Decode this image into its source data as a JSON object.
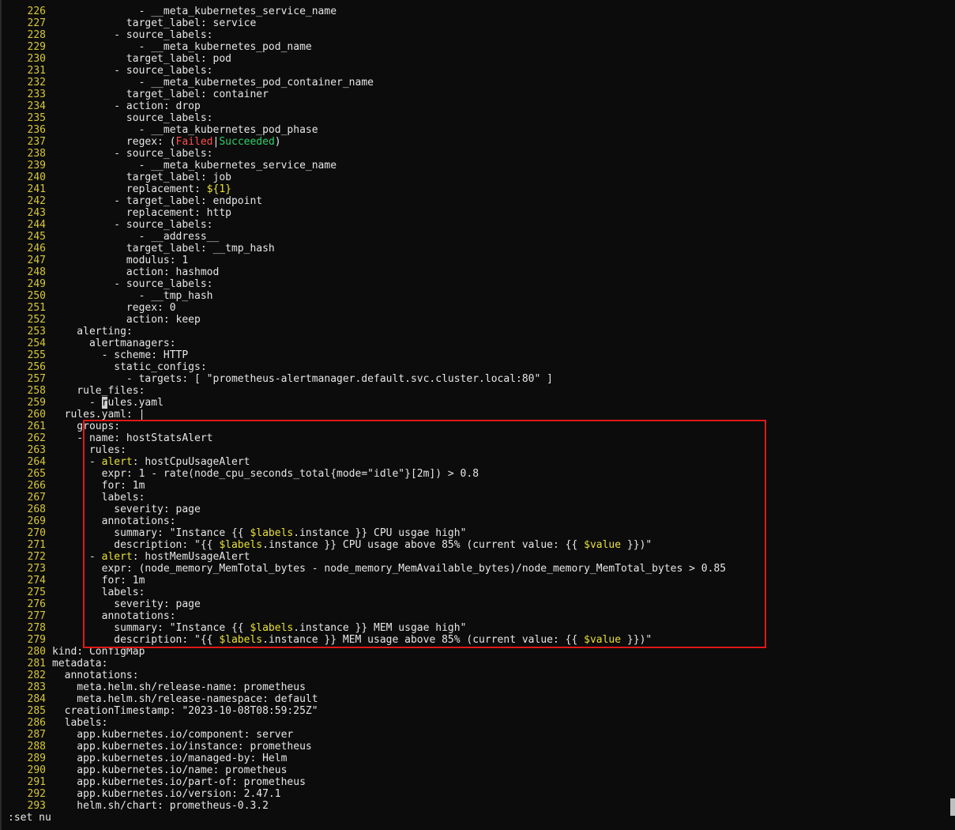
{
  "editor": {
    "lines": [
      {
        "n": "226",
        "segs": [
          {
            "t": "              - __meta_kubernetes_service_name"
          }
        ]
      },
      {
        "n": "227",
        "segs": [
          {
            "t": "            target_label: service"
          }
        ]
      },
      {
        "n": "228",
        "segs": [
          {
            "t": "          - source_labels:"
          }
        ]
      },
      {
        "n": "229",
        "segs": [
          {
            "t": "              - __meta_kubernetes_pod_name"
          }
        ]
      },
      {
        "n": "230",
        "segs": [
          {
            "t": "            target_label: pod"
          }
        ]
      },
      {
        "n": "231",
        "segs": [
          {
            "t": "          - source_labels:"
          }
        ]
      },
      {
        "n": "232",
        "segs": [
          {
            "t": "              - __meta_kubernetes_pod_container_name"
          }
        ]
      },
      {
        "n": "233",
        "segs": [
          {
            "t": "            target_label: container"
          }
        ]
      },
      {
        "n": "234",
        "segs": [
          {
            "t": "          - action: drop"
          }
        ]
      },
      {
        "n": "235",
        "segs": [
          {
            "t": "            source_labels:"
          }
        ]
      },
      {
        "n": "236",
        "segs": [
          {
            "t": "              - __meta_kubernetes_pod_phase"
          }
        ]
      },
      {
        "n": "237",
        "segs": [
          {
            "t": "            regex: ("
          },
          {
            "t": "Failed",
            "c": "red"
          },
          {
            "t": "|"
          },
          {
            "t": "Succeeded",
            "c": "green"
          },
          {
            "t": ")"
          }
        ]
      },
      {
        "n": "238",
        "segs": [
          {
            "t": "          - source_labels:"
          }
        ]
      },
      {
        "n": "239",
        "segs": [
          {
            "t": "              - __meta_kubernetes_service_name"
          }
        ]
      },
      {
        "n": "240",
        "segs": [
          {
            "t": "            target_label: job"
          }
        ]
      },
      {
        "n": "241",
        "segs": [
          {
            "t": "            replacement: "
          },
          {
            "t": "${1}",
            "c": "yellow"
          }
        ]
      },
      {
        "n": "242",
        "segs": [
          {
            "t": "          - target_label: endpoint"
          }
        ]
      },
      {
        "n": "243",
        "segs": [
          {
            "t": "            replacement: http"
          }
        ]
      },
      {
        "n": "244",
        "segs": [
          {
            "t": "          - source_labels:"
          }
        ]
      },
      {
        "n": "245",
        "segs": [
          {
            "t": "              - __address__"
          }
        ]
      },
      {
        "n": "246",
        "segs": [
          {
            "t": "            target_label: __tmp_hash"
          }
        ]
      },
      {
        "n": "247",
        "segs": [
          {
            "t": "            modulus: 1"
          }
        ]
      },
      {
        "n": "248",
        "segs": [
          {
            "t": "            action: hashmod"
          }
        ]
      },
      {
        "n": "249",
        "segs": [
          {
            "t": "          - source_labels:"
          }
        ]
      },
      {
        "n": "250",
        "segs": [
          {
            "t": "              - __tmp_hash"
          }
        ]
      },
      {
        "n": "251",
        "segs": [
          {
            "t": "            regex: 0"
          }
        ]
      },
      {
        "n": "252",
        "segs": [
          {
            "t": "            action: keep"
          }
        ]
      },
      {
        "n": "253",
        "segs": [
          {
            "t": "    alerting:"
          }
        ]
      },
      {
        "n": "254",
        "segs": [
          {
            "t": "      alertmanagers:"
          }
        ]
      },
      {
        "n": "255",
        "segs": [
          {
            "t": "        - scheme: HTTP"
          }
        ]
      },
      {
        "n": "256",
        "segs": [
          {
            "t": "          static_configs:"
          }
        ]
      },
      {
        "n": "257",
        "segs": [
          {
            "t": "            - targets: [ \"prometheus-alertmanager.default.svc.cluster.local:80\" ]"
          }
        ]
      },
      {
        "n": "258",
        "segs": [
          {
            "t": "    rule_files:"
          }
        ]
      },
      {
        "n": "259",
        "segs": [
          {
            "t": "      - "
          },
          {
            "t": "r",
            "c": "cursor"
          },
          {
            "t": "ules.yaml"
          }
        ]
      },
      {
        "n": "260",
        "segs": [
          {
            "t": "  rules.yaml: |"
          }
        ]
      },
      {
        "n": "261",
        "segs": [
          {
            "t": "    groups:"
          }
        ]
      },
      {
        "n": "262",
        "segs": [
          {
            "t": "    - name: hostStatsAlert"
          }
        ]
      },
      {
        "n": "263",
        "segs": [
          {
            "t": "      rules:"
          }
        ]
      },
      {
        "n": "264",
        "segs": [
          {
            "t": "      - "
          },
          {
            "t": "alert",
            "c": "yellow"
          },
          {
            "t": ": hostCpuUsageAlert"
          }
        ]
      },
      {
        "n": "265",
        "segs": [
          {
            "t": "        expr: 1 - rate(node_cpu_seconds_total{mode=\"idle\"}[2m]) > 0.8"
          }
        ]
      },
      {
        "n": "266",
        "segs": [
          {
            "t": "        for: 1m"
          }
        ]
      },
      {
        "n": "267",
        "segs": [
          {
            "t": "        labels:"
          }
        ]
      },
      {
        "n": "268",
        "segs": [
          {
            "t": "          severity: page"
          }
        ]
      },
      {
        "n": "269",
        "segs": [
          {
            "t": "        annotations:"
          }
        ]
      },
      {
        "n": "270",
        "segs": [
          {
            "t": "          summary: \"Instance {{ "
          },
          {
            "t": "$labels",
            "c": "yellow"
          },
          {
            "t": ".instance }} CPU usgae high\""
          }
        ]
      },
      {
        "n": "271",
        "segs": [
          {
            "t": "          description: \"{{ "
          },
          {
            "t": "$labels",
            "c": "yellow"
          },
          {
            "t": ".instance }} CPU usage above 85% (current value: {{ "
          },
          {
            "t": "$value",
            "c": "yellow"
          },
          {
            "t": " }})\""
          }
        ]
      },
      {
        "n": "272",
        "segs": [
          {
            "t": "      - "
          },
          {
            "t": "alert",
            "c": "yellow"
          },
          {
            "t": ": hostMemUsageAlert"
          }
        ]
      },
      {
        "n": "273",
        "segs": [
          {
            "t": "        expr: (node_memory_MemTotal_bytes - node_memory_MemAvailable_bytes)/node_memory_MemTotal_bytes > 0.85"
          }
        ]
      },
      {
        "n": "274",
        "segs": [
          {
            "t": "        for: 1m"
          }
        ]
      },
      {
        "n": "275",
        "segs": [
          {
            "t": "        labels:"
          }
        ]
      },
      {
        "n": "276",
        "segs": [
          {
            "t": "          severity: page"
          }
        ]
      },
      {
        "n": "277",
        "segs": [
          {
            "t": "        annotations:"
          }
        ]
      },
      {
        "n": "278",
        "segs": [
          {
            "t": "          summary: \"Instance {{ "
          },
          {
            "t": "$labels",
            "c": "yellow"
          },
          {
            "t": ".instance }} MEM usgae high\""
          }
        ]
      },
      {
        "n": "279",
        "segs": [
          {
            "t": "          description: \"{{ "
          },
          {
            "t": "$labels",
            "c": "yellow"
          },
          {
            "t": ".instance }} MEM usage above 85% (current value: {{ "
          },
          {
            "t": "$value",
            "c": "yellow"
          },
          {
            "t": " }})\""
          }
        ]
      },
      {
        "n": "280",
        "segs": [
          {
            "t": "kind: ConfigMap"
          }
        ]
      },
      {
        "n": "281",
        "segs": [
          {
            "t": "metadata:"
          }
        ]
      },
      {
        "n": "282",
        "segs": [
          {
            "t": "  annotations:"
          }
        ]
      },
      {
        "n": "283",
        "segs": [
          {
            "t": "    meta.helm.sh/release-name: prometheus"
          }
        ]
      },
      {
        "n": "284",
        "segs": [
          {
            "t": "    meta.helm.sh/release-namespace: default"
          }
        ]
      },
      {
        "n": "285",
        "segs": [
          {
            "t": "  creationTimestamp: \"2023-10-08T08:59:25Z\""
          }
        ]
      },
      {
        "n": "286",
        "segs": [
          {
            "t": "  labels:"
          }
        ]
      },
      {
        "n": "287",
        "segs": [
          {
            "t": "    app.kubernetes.io/component: server"
          }
        ]
      },
      {
        "n": "288",
        "segs": [
          {
            "t": "    app.kubernetes.io/instance: prometheus"
          }
        ]
      },
      {
        "n": "289",
        "segs": [
          {
            "t": "    app.kubernetes.io/managed-by: Helm"
          }
        ]
      },
      {
        "n": "290",
        "segs": [
          {
            "t": "    app.kubernetes.io/name: prometheus"
          }
        ]
      },
      {
        "n": "291",
        "segs": [
          {
            "t": "    app.kubernetes.io/part-of: prometheus"
          }
        ]
      },
      {
        "n": "292",
        "segs": [
          {
            "t": "    app.kubernetes.io/version: 2.47.1"
          }
        ]
      },
      {
        "n": "293",
        "segs": [
          {
            "t": "    helm.sh/chart: prometheus-0.3.2"
          }
        ]
      }
    ]
  },
  "command_line": {
    "text": ":set nu"
  },
  "colors": {
    "line_number": "#d7c73a",
    "text": "#e6e6e6",
    "background": "#0c0c0c",
    "string_red": "#ff4d4d",
    "string_green": "#2bd16b",
    "keyword_yellow": "#e8e034",
    "highlight_box": "#e01818"
  }
}
